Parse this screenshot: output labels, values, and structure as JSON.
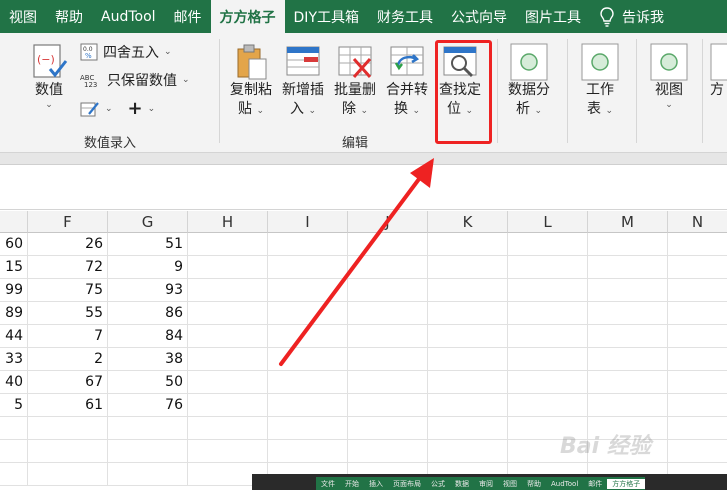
{
  "tabs": [
    {
      "label": "视图"
    },
    {
      "label": "帮助"
    },
    {
      "label": "AudTool"
    },
    {
      "label": "邮件"
    },
    {
      "label": "方方格子",
      "active": true
    },
    {
      "label": "DIY工具箱"
    },
    {
      "label": "财务工具"
    },
    {
      "label": "公式向导"
    },
    {
      "label": "图片工具"
    }
  ],
  "tell_me": "告诉我",
  "ribbon": {
    "numeric": {
      "big_label": "数值",
      "round_label": "四舍五入",
      "keep_value_label": "只保留数值",
      "group_label": "数值录入"
    },
    "edit": {
      "copy_paste": [
        "复制粘",
        "贴"
      ],
      "insert": [
        "新增插",
        "入"
      ],
      "batch_delete": [
        "批量删",
        "除"
      ],
      "merge": [
        "合并转",
        "换"
      ],
      "find": [
        "查找定",
        "位"
      ],
      "group_label": "编辑"
    },
    "analysis": [
      "数据分",
      "析"
    ],
    "worksheet": [
      "工作",
      "表"
    ],
    "view": "视图",
    "partial": "方"
  },
  "columns": [
    "F",
    "G",
    "H",
    "I",
    "J",
    "K",
    "L",
    "M",
    "N"
  ],
  "rows": [
    [
      "60",
      "26",
      "51"
    ],
    [
      "15",
      "72",
      "9"
    ],
    [
      "99",
      "75",
      "93"
    ],
    [
      "89",
      "55",
      "86"
    ],
    [
      "44",
      "7",
      "84"
    ],
    [
      "33",
      "2",
      "38"
    ],
    [
      "40",
      "67",
      "50"
    ],
    [
      "5",
      "61",
      "76"
    ]
  ],
  "thumbnail_tabs": [
    "文件",
    "开始",
    "插入",
    "页面布局",
    "公式",
    "数据",
    "审阅",
    "视图",
    "帮助",
    "AudTool",
    "邮件",
    "方方格子"
  ],
  "watermark": "Bai 经验",
  "colors": {
    "brand": "#217346",
    "highlight": "#ee2222"
  }
}
